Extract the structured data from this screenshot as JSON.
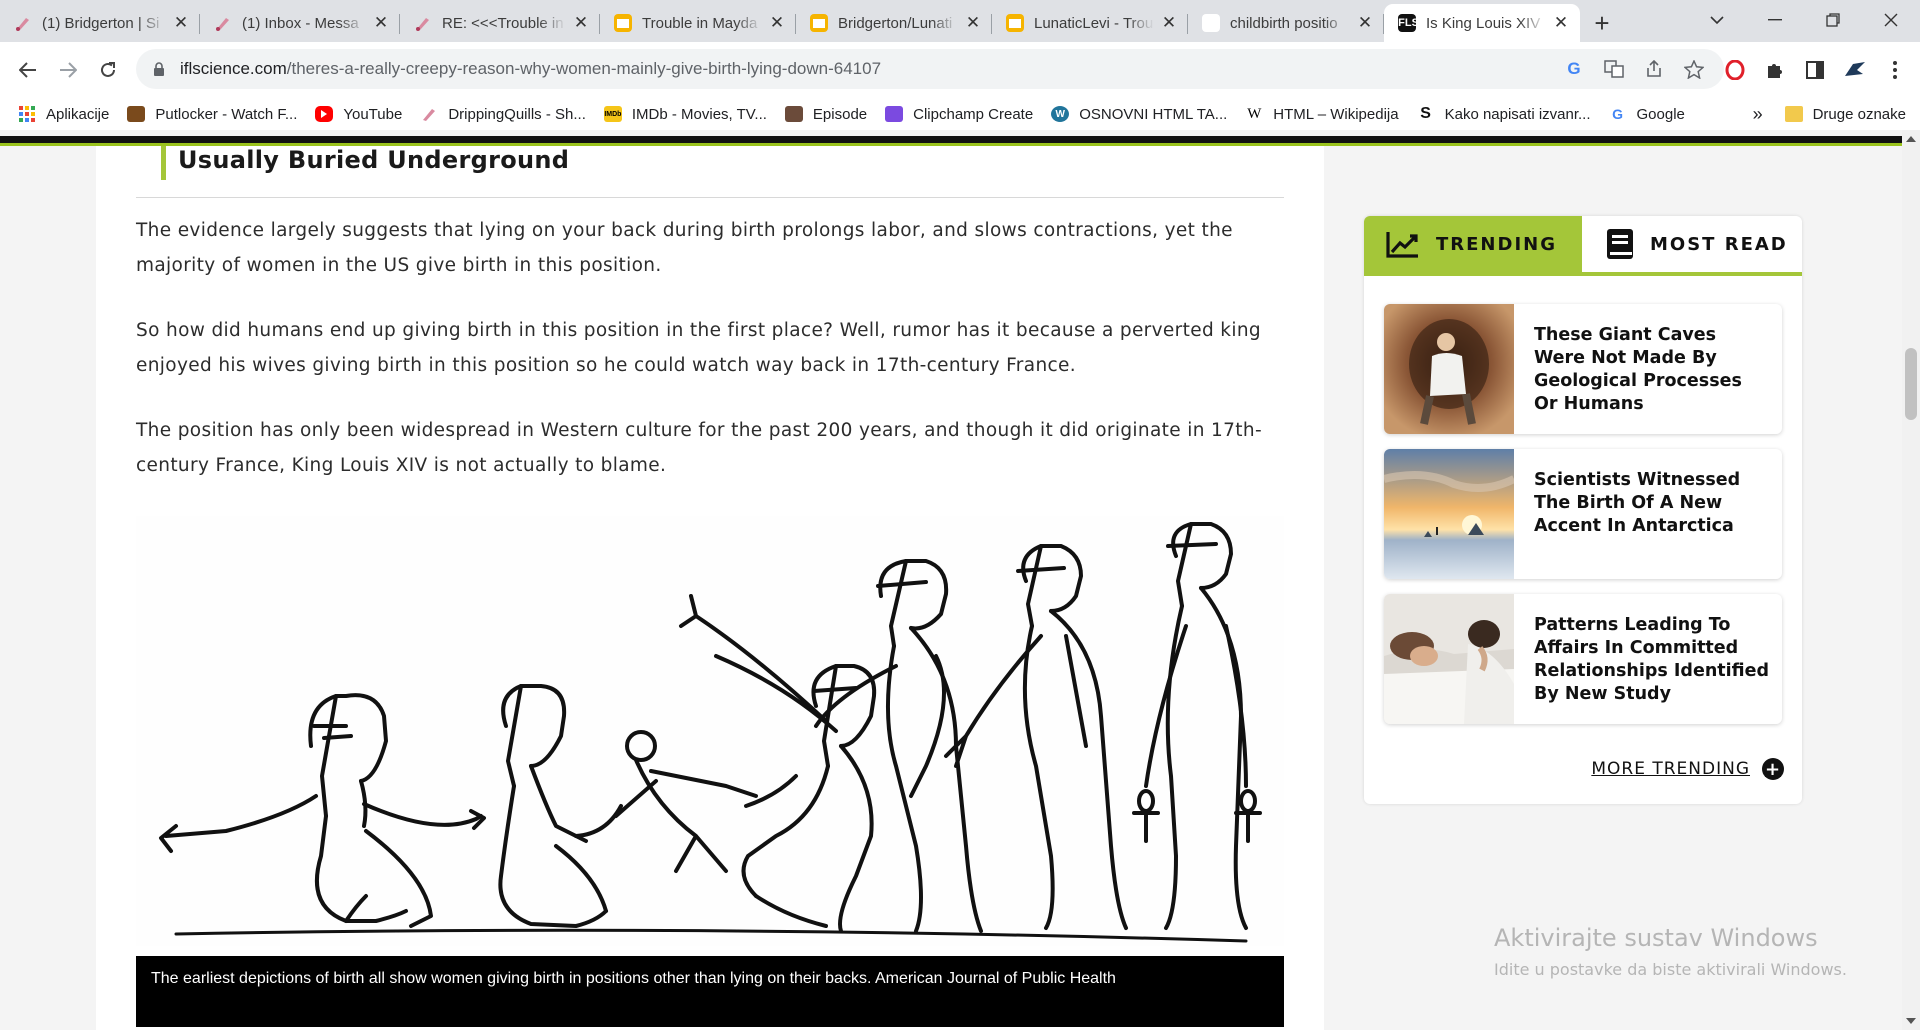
{
  "browser": {
    "tabs": [
      {
        "title": "(1) Bridgerton | Si",
        "icon": "drippingquills-icon"
      },
      {
        "title": "(1) Inbox - Messa",
        "icon": "drippingquills-icon"
      },
      {
        "title": "RE: <<<Trouble in",
        "icon": "drippingquills-icon"
      },
      {
        "title": "Trouble in Mayda",
        "icon": "google-slides-icon"
      },
      {
        "title": "Bridgerton/Lunati",
        "icon": "google-slides-icon"
      },
      {
        "title": "LunaticLevi - Trou",
        "icon": "google-slides-icon"
      },
      {
        "title": "childbirth positio",
        "icon": "google-icon"
      },
      {
        "title": "Is King Louis XIV",
        "icon": "iflscience-icon"
      }
    ],
    "new_tab": "+",
    "url_host": "iflscience.com",
    "url_path": "/theres-a-really-creepy-reason-why-women-mainly-give-birth-lying-down-64107",
    "bookmarks": [
      {
        "label": "Aplikacije",
        "icon": "apps-grid-icon"
      },
      {
        "label": "Putlocker - Watch F...",
        "icon": "putlocker-icon"
      },
      {
        "label": "YouTube",
        "icon": "youtube-icon"
      },
      {
        "label": "DrippingQuills - Sh...",
        "icon": "drippingquills-icon"
      },
      {
        "label": "IMDb - Movies, TV...",
        "icon": "imdb-icon"
      },
      {
        "label": "Episode",
        "icon": "episode-icon"
      },
      {
        "label": "Clipchamp Create",
        "icon": "clipchamp-icon"
      },
      {
        "label": "OSNOVNI HTML TA...",
        "icon": "wordpress-icon"
      },
      {
        "label": "HTML – Wikipedija",
        "icon": "wikipedia-icon"
      },
      {
        "label": "Kako napisati izvanr...",
        "icon": "s-icon"
      },
      {
        "label": "Google",
        "icon": "google-icon"
      }
    ],
    "bookmarks_overflow": "»",
    "other_bookmarks": "Druge oznake"
  },
  "article": {
    "section_heading": "Usually Buried Underground",
    "paragraphs": [
      "The evidence largely suggests that lying on your back during birth prolongs labor, and slows contractions, yet the majority of women in the US give birth in this position.",
      "So how did humans end up giving birth in this position in the first place? Well, rumor has it because a perverted king enjoyed his wives giving birth in this position so he could watch way back in 17th-century France.",
      "The position has only been widespread in Western culture for the past 200 years, and though it did originate in 17th-century France, King Louis XIV is not actually to blame."
    ],
    "figure_caption": "The earliest depictions of birth all show women giving birth in positions other than lying on their backs. American Journal of Public Health"
  },
  "sidebar": {
    "tab_trending": "TRENDING",
    "tab_most_read": "MOST READ",
    "cards": [
      {
        "title": "These Giant Caves Were Not Made By Geological Processes Or Humans"
      },
      {
        "title": "Scientists Witnessed The Birth Of A New Accent In Antarctica"
      },
      {
        "title": "Patterns Leading To Affairs In Committed Relationships Identified By New Study"
      }
    ],
    "more_trending": "MORE TRENDING"
  },
  "watermark": {
    "line1": "Aktivirajte sustav Windows",
    "line2": "Idite u postavke da biste aktivirali Windows."
  },
  "colors": {
    "accent_green": "#a4c639",
    "tabstrip": "#dfe1e5"
  }
}
